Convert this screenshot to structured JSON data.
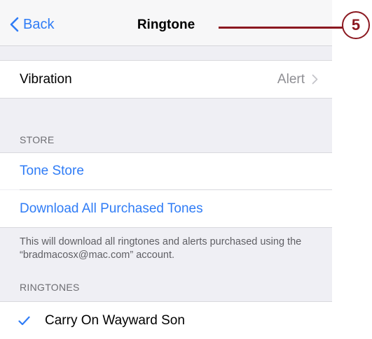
{
  "navbar": {
    "back_label": "Back",
    "title": "Ringtone"
  },
  "vibration": {
    "label": "Vibration",
    "value": "Alert"
  },
  "store": {
    "header": "STORE",
    "tone_store": "Tone Store",
    "download_all": "Download All Purchased Tones",
    "footer": "This will download all ringtones and alerts purchased using the “bradmacosx@mac.com” account."
  },
  "ringtones": {
    "header": "RINGTONES",
    "items": [
      {
        "label": "Carry On Wayward Son",
        "selected": true
      }
    ]
  },
  "callout": {
    "number": "5"
  },
  "colors": {
    "accent": "#2f7cf6",
    "background": "#efeff4",
    "callout": "#8b1820"
  }
}
